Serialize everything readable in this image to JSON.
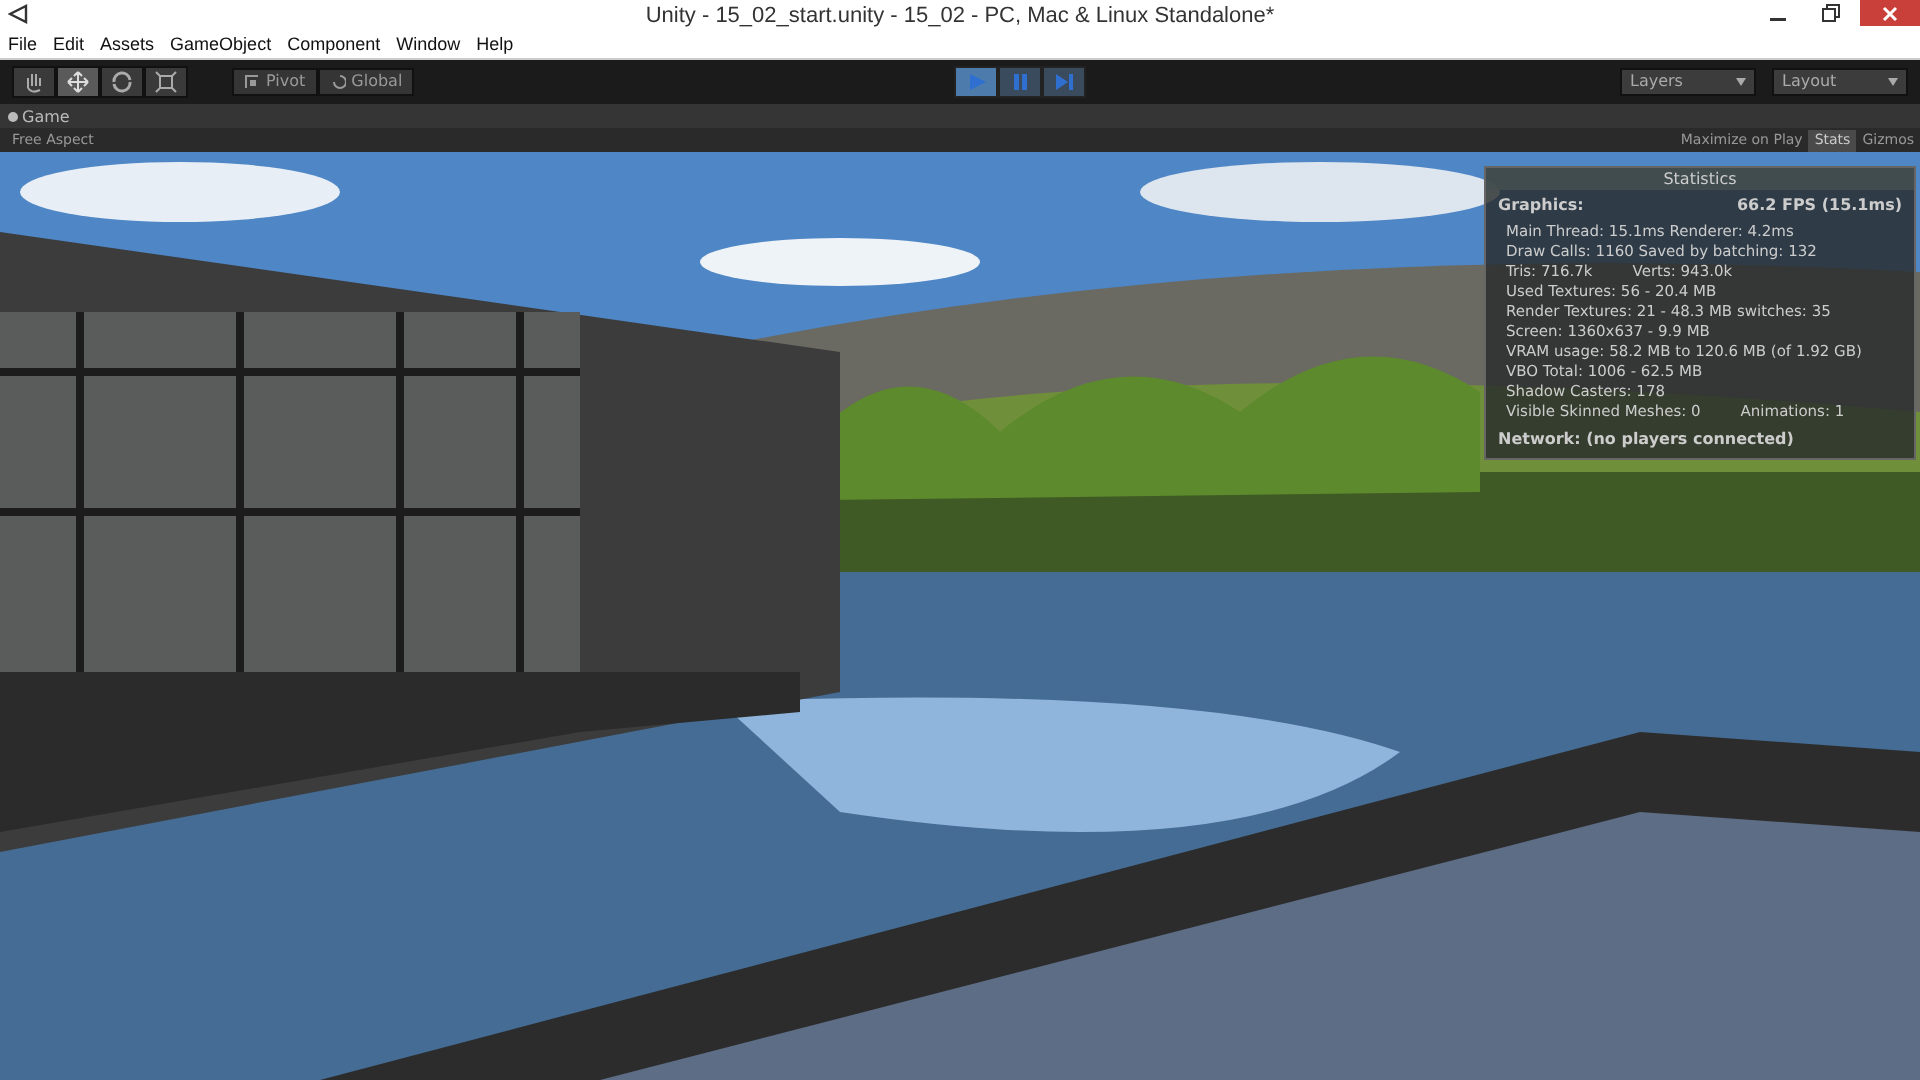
{
  "window": {
    "title": "Unity - 15_02_start.unity - 15_02 - PC, Mac & Linux Standalone*"
  },
  "menu": [
    "File",
    "Edit",
    "Assets",
    "GameObject",
    "Component",
    "Window",
    "Help"
  ],
  "tools": [
    {
      "kind": "hand",
      "selected": false
    },
    {
      "kind": "move",
      "selected": true
    },
    {
      "kind": "rotate",
      "selected": false
    },
    {
      "kind": "scale",
      "selected": false
    }
  ],
  "handle_toggles": [
    {
      "kind": "pivot",
      "label": "Pivot"
    },
    {
      "kind": "global",
      "label": "Global"
    }
  ],
  "playback": [
    {
      "kind": "play",
      "on": true
    },
    {
      "kind": "pause",
      "on": false
    },
    {
      "kind": "step",
      "on": false
    }
  ],
  "dropdowns": [
    {
      "label": "Layers"
    },
    {
      "label": "Layout"
    }
  ],
  "game_tab": {
    "label": "Game",
    "aspect": "Free Aspect",
    "options": [
      {
        "label": "Maximize on Play",
        "on": false
      },
      {
        "label": "Stats",
        "on": true
      },
      {
        "label": "Gizmos",
        "on": false
      }
    ]
  },
  "statistics": {
    "title": "Statistics",
    "heading": "Graphics:",
    "fps": "66.2 FPS (15.1ms)",
    "lines": [
      {
        "left": "Main Thread: 15.1ms  Renderer: 4.2ms"
      },
      {
        "left": "Draw Calls: 1160 Saved by batching: 132"
      },
      {
        "left": "Tris: 716.7k",
        "right": "Verts: 943.0k"
      },
      {
        "left": "Used Textures: 56 - 20.4 MB"
      },
      {
        "left": "Render Textures: 21 - 48.3 MB  switches: 35"
      },
      {
        "left": "Screen: 1360x637 - 9.9 MB"
      },
      {
        "left": "VRAM usage: 58.2 MB to 120.6 MB (of 1.92 GB)"
      },
      {
        "left": "VBO Total: 1006 - 62.5 MB"
      },
      {
        "left": "Shadow Casters: 178"
      },
      {
        "left": "Visible Skinned Meshes: 0",
        "right": "Animations: 1"
      }
    ],
    "network": "Network: (no players connected)"
  }
}
